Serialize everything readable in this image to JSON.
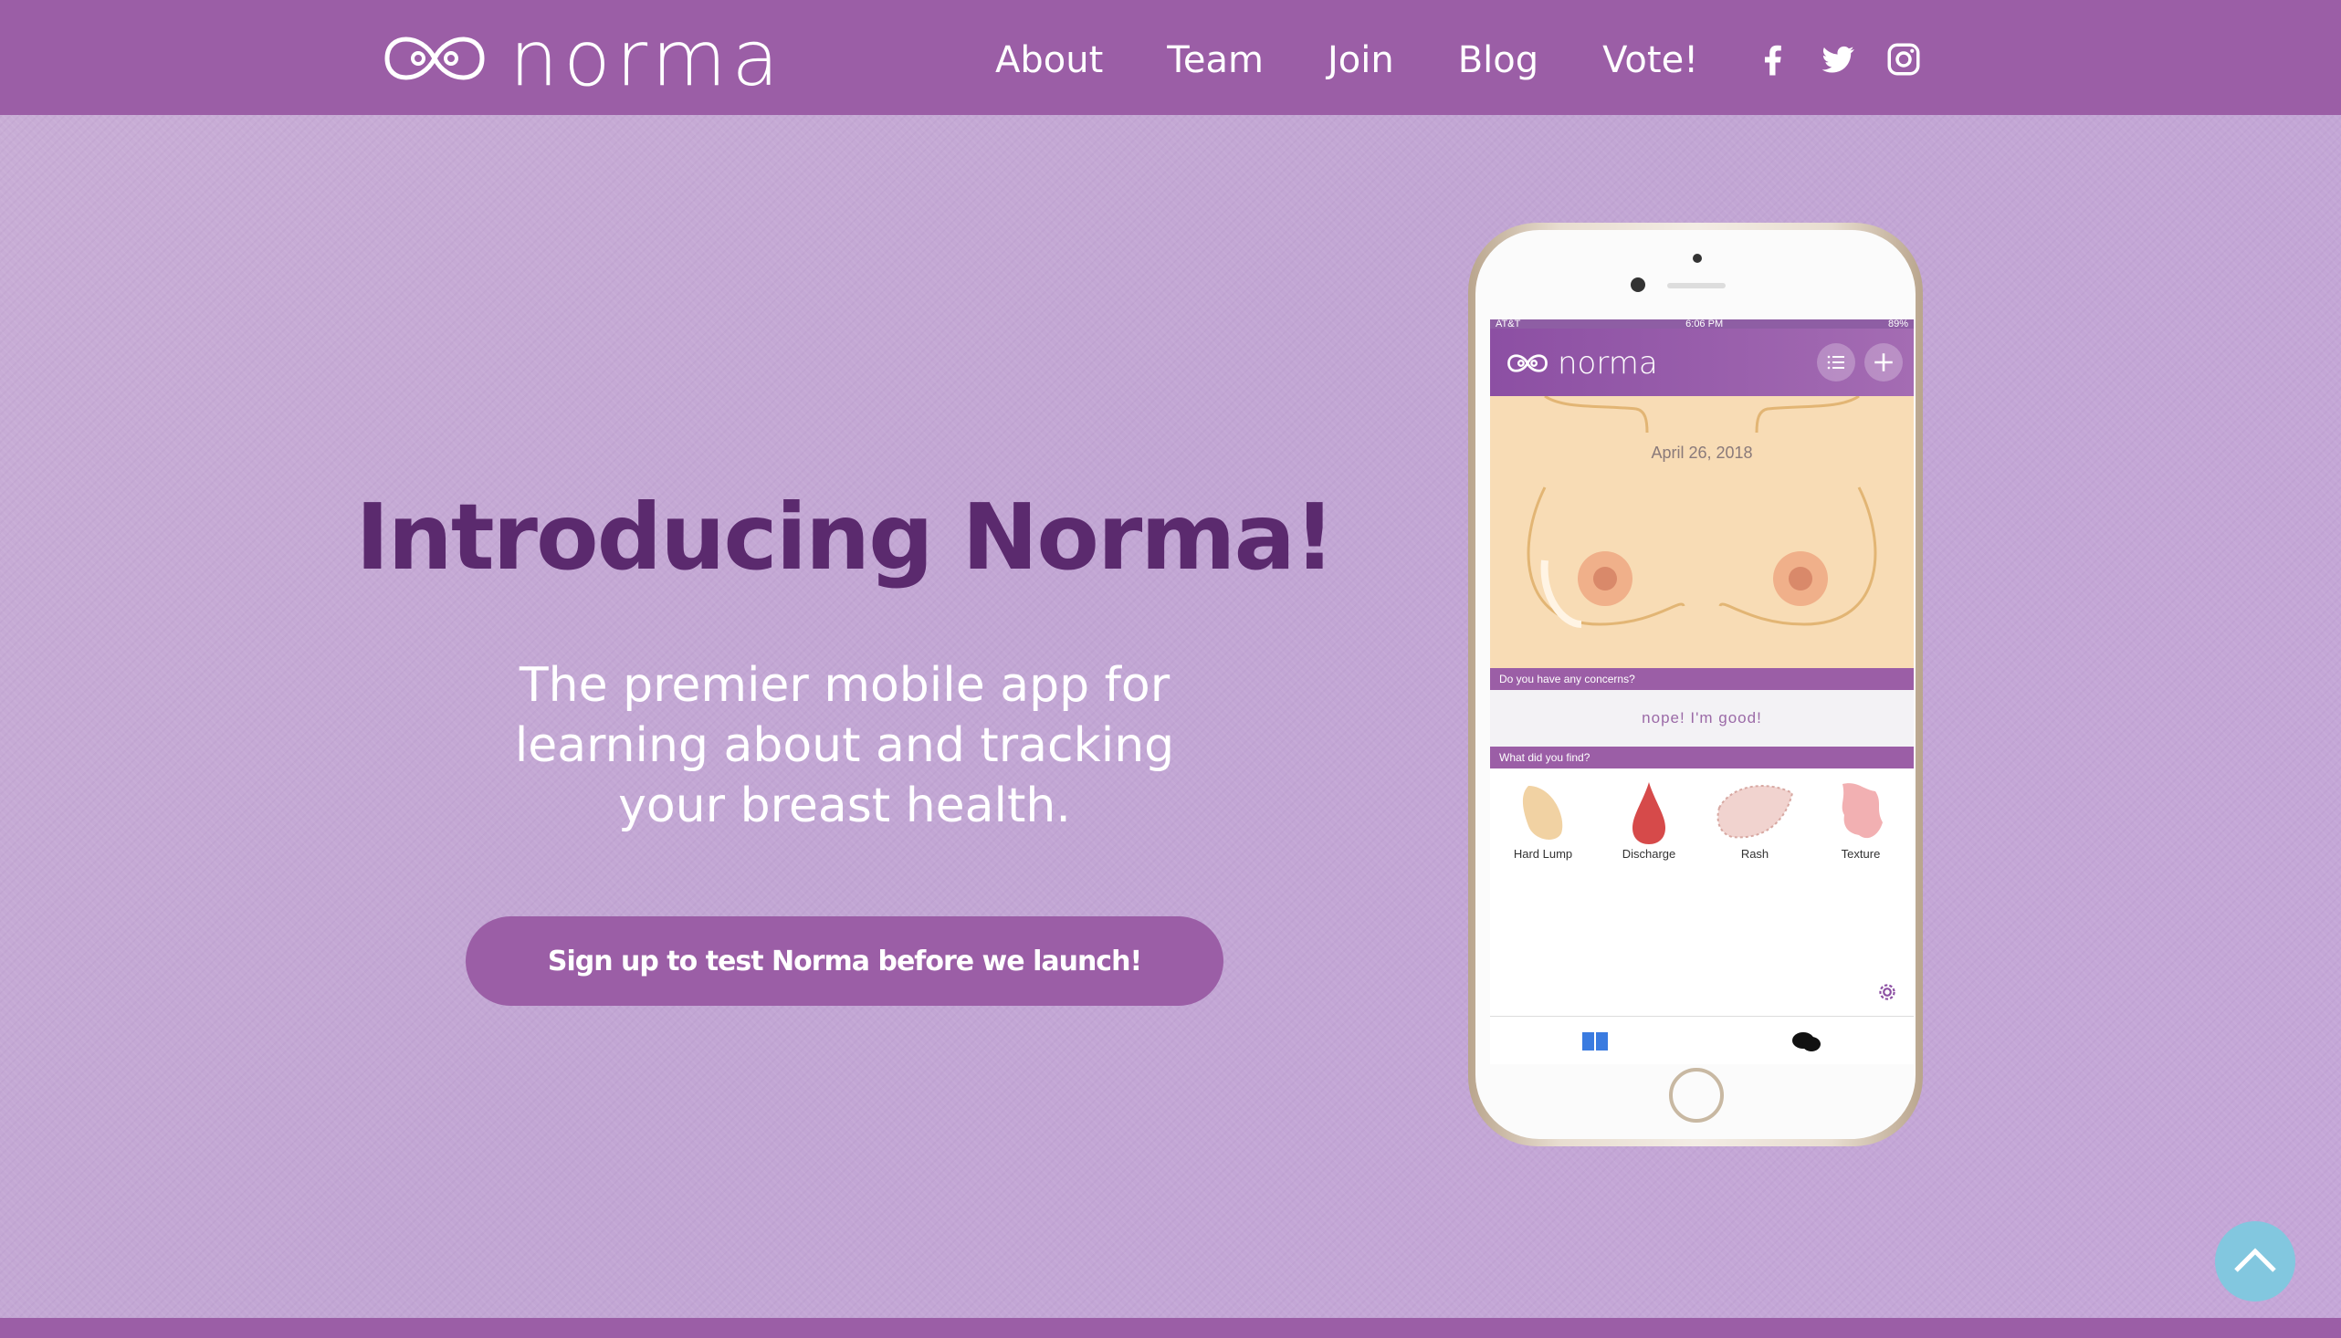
{
  "header": {
    "logo_text": "norma",
    "nav": [
      "About",
      "Team",
      "Join",
      "Blog",
      "Vote!"
    ],
    "social": [
      "facebook-icon",
      "twitter-icon",
      "instagram-icon"
    ]
  },
  "hero": {
    "title": "Introducing Norma!",
    "subtitle_line1": "The premier mobile app for",
    "subtitle_line2": "learning about and tracking",
    "subtitle_line3": "your breast health.",
    "cta": "Sign up to test Norma before we launch!"
  },
  "phone": {
    "carrier": "AT&T",
    "time": "6:06 PM",
    "battery": "89%",
    "app_name": "norma",
    "date": "April 26, 2018",
    "concern_bar": "Do you have any concerns?",
    "concern_answer": "nope! I'm good!",
    "find_bar": "What did you find?",
    "finds": [
      "Hard Lump",
      "Discharge",
      "Rash",
      "Texture"
    ]
  },
  "colors": {
    "header": "#9b5ea6",
    "title": "#5b2a6e",
    "scroll_button": "#82c7df"
  }
}
